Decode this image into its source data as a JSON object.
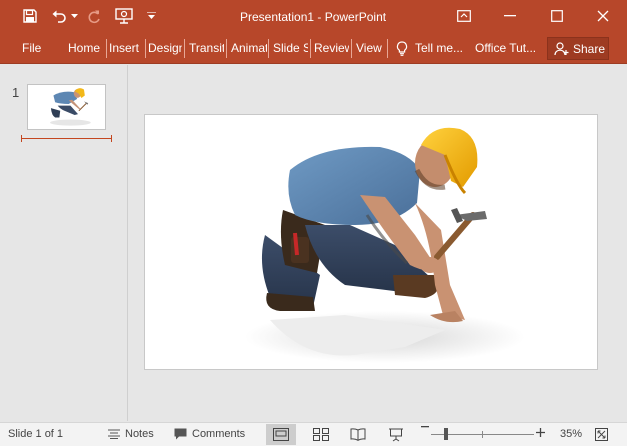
{
  "window": {
    "title": "Presentation1  -  PowerPoint",
    "accent": "#b7472a"
  },
  "quick_access": {
    "icons": [
      "save-icon",
      "undo-icon",
      "undo-dropdown-icon",
      "redo-icon",
      "start-from-beginning-icon",
      "customize-qat-icon"
    ]
  },
  "window_controls": {
    "icons": [
      "ribbon-display-options-icon",
      "minimize-icon",
      "maximize-icon",
      "close-icon"
    ]
  },
  "ribbon": {
    "tabs": [
      "File",
      "Home",
      "Insert",
      "Design",
      "Transitions",
      "Animations",
      "Slide Show",
      "Review",
      "View"
    ],
    "tell_me": "Tell me...",
    "office_tut": "Office Tut...",
    "share": "Share"
  },
  "thumbnails": {
    "slide_number": "1"
  },
  "statusbar": {
    "slide_info": "Slide 1 of 1",
    "notes": "Notes",
    "comments": "Comments",
    "zoom": "35%",
    "zoom_level": 35
  }
}
